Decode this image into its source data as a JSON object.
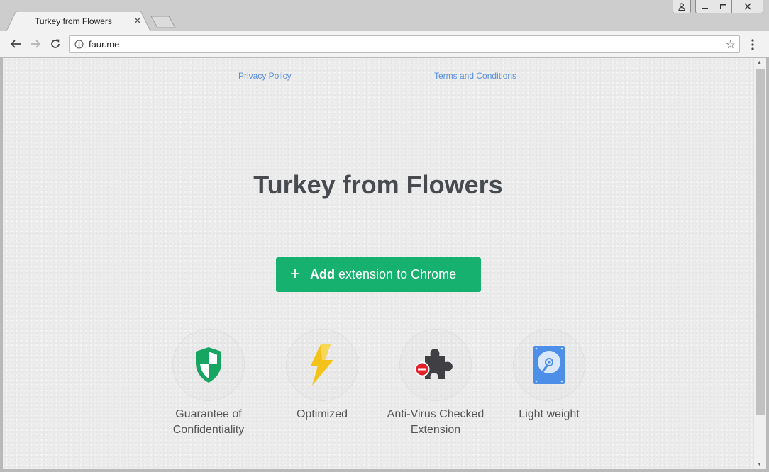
{
  "browser": {
    "tab_title": "Turkey from Flowers",
    "tab_close": "✕",
    "url": "faur.me"
  },
  "page": {
    "links": {
      "privacy": "Privacy Policy",
      "terms": "Terms and Conditions"
    },
    "title": "Turkey from Flowers",
    "cta": {
      "plus": "+",
      "bold": "Add",
      "rest": " extension to Chrome"
    },
    "features": [
      {
        "label": "Guarantee of Confidentiality",
        "icon": "shield-icon"
      },
      {
        "label": "Optimized",
        "icon": "lightning-icon"
      },
      {
        "label": "Anti-Virus Checked Extension",
        "icon": "puzzle-icon"
      },
      {
        "label": "Light weight",
        "icon": "hard-drive-icon"
      }
    ]
  },
  "colors": {
    "cta": "#16b06f",
    "link": "#5a8fdc",
    "title": "#474a4f",
    "shield": "#17a661",
    "bolt": "#f3c21b",
    "drive": "#4d8ee8"
  }
}
